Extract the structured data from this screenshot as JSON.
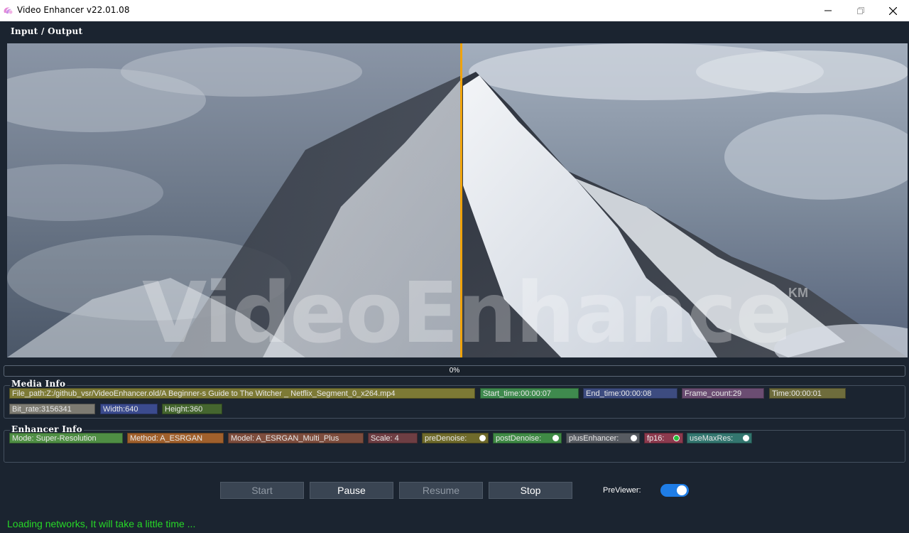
{
  "window": {
    "title": "Video Enhancer v22.01.08",
    "icon": "app-logo-icon"
  },
  "io_panel": {
    "label": "Input / Output",
    "watermark": "VideoEnhance",
    "watermark_tm": "KM"
  },
  "progress": {
    "value": 0,
    "text": "0%"
  },
  "media_info": {
    "label": "Media Info",
    "file_path": "File_path:Z:/github_vsr/VideoEnhancer.old/A Beginner-s Guide to The Witcher _ Netflix_Segment_0_x264.mp4",
    "start_time": "Start_time:00:00:07",
    "end_time": "End_time:00:00:08",
    "frame_count": "Frame_count:29",
    "time": "Time:00:00:01",
    "bit_rate": "Bit_rate:3156341",
    "width": "Width:640",
    "height": "Height:360"
  },
  "enhancer_info": {
    "label": "Enhancer Info",
    "mode": "Mode: Super-Resolution",
    "method": "Method: A_ESRGAN",
    "model": "Model: A_ESRGAN_Multi_Plus",
    "scale": "Scale: 4",
    "pre_denoise": "preDenoise:",
    "pre_denoise_on": false,
    "post_denoise": "postDenoise:",
    "post_denoise_on": false,
    "plus_enhancer": "plusEnhancer:",
    "plus_enhancer_on": false,
    "fp16": "fp16:",
    "fp16_on": true,
    "use_max_res": "useMaxRes:",
    "use_max_res_on": false
  },
  "controls": {
    "start": "Start",
    "pause": "Pause",
    "resume": "Resume",
    "stop": "Stop",
    "previewer_label": "PreViewer:",
    "previewer_on": true
  },
  "status": "Loading networks, It will take a little time ...",
  "colors": {
    "background": "#1b2430",
    "accent_line": "#f0a30a",
    "status_text": "#27d827",
    "toggle_on": "#1f7de6"
  }
}
